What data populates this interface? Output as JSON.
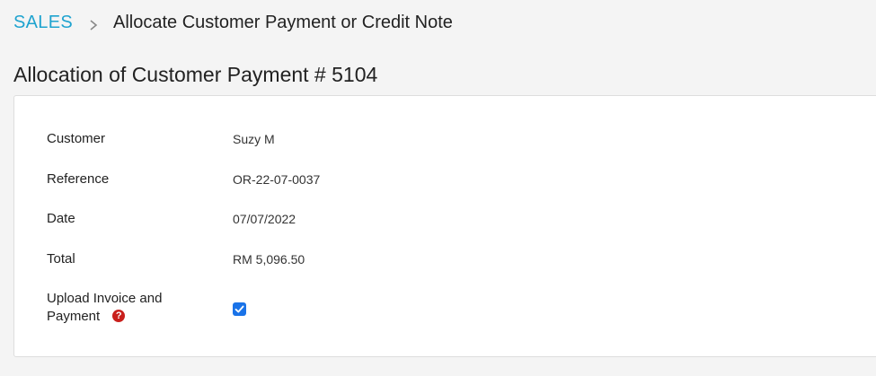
{
  "breadcrumb": {
    "section": "SALES",
    "current": "Allocate Customer Payment or Credit Note"
  },
  "page": {
    "title": "Allocation of Customer Payment # 5104"
  },
  "fields": {
    "customer": {
      "label": "Customer",
      "value": "Suzy M"
    },
    "reference": {
      "label": "Reference",
      "value": "OR-22-07-0037"
    },
    "date": {
      "label": "Date",
      "value": "07/07/2022"
    },
    "total": {
      "label": "Total",
      "value": "RM 5,096.50"
    },
    "upload": {
      "label_line1": "Upload Invoice and",
      "label_line2": "Payment",
      "help_glyph": "?",
      "checked": true
    }
  },
  "colors": {
    "link": "#1fa3cf",
    "checkbox": "#1a73e8",
    "help_icon": "#c9201c"
  },
  "icons": {
    "separator": "chevron-right-icon",
    "help": "help-circle-icon",
    "check": "check-icon"
  }
}
